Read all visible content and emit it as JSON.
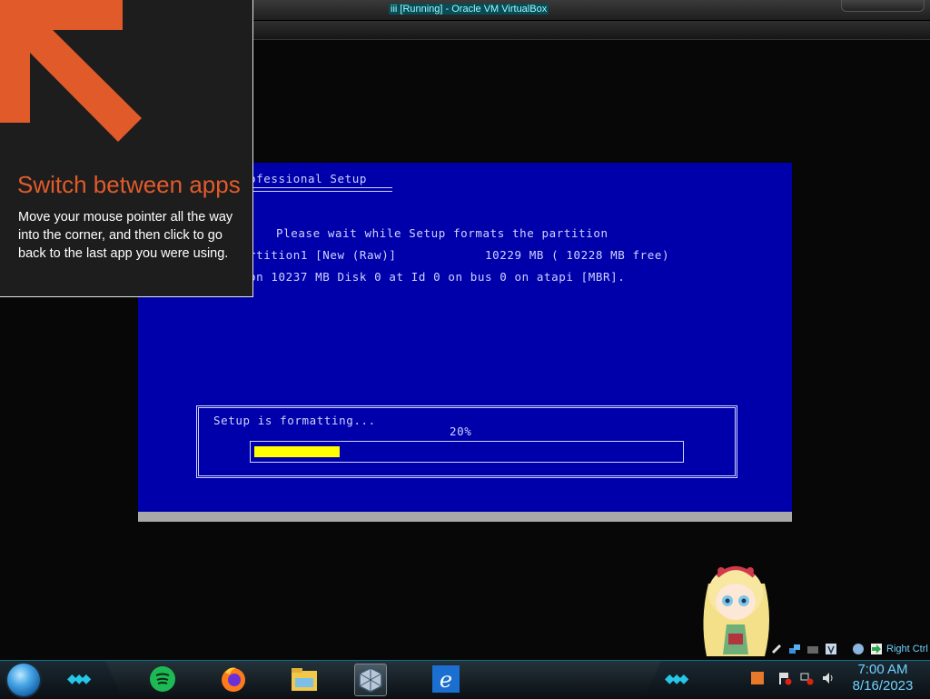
{
  "window": {
    "title": "iii [Running] - Oracle VM VirtualBox"
  },
  "vm": {
    "setup_title": "ofessional Setup",
    "lines": [
      "Please wait while Setup formats the partition",
      "rtition1 [New (Raw)]            10229 MB ( 10228 MB free)",
      "on 10237 MB Disk 0 at Id 0 on bus 0 on atapi [MBR]."
    ],
    "format_label": "Setup is formatting...",
    "percent_label": "20%",
    "progress": 0.2,
    "background_color": "#0000aa",
    "progress_color": "#ffff00"
  },
  "hint": {
    "title": "Switch between apps",
    "body": "Move your mouse pointer all the way into the corner, and then click to go back to the last app you were using.",
    "accent_color": "#e15b2a"
  },
  "tray": {
    "upper_icons": [
      "usb-icon",
      "network-icon",
      "folder-icon",
      "virtualbox-vm-icon",
      "globe-icon",
      "green-arrow-icon"
    ],
    "host_key_label": "Right Ctrl",
    "lower_icons": [
      "orange-app-icon",
      "flag-icon",
      "network-icon",
      "volume-icon"
    ]
  },
  "taskbar": {
    "apps": [
      "spotify-icon",
      "firefox-icon",
      "file-explorer-icon",
      "virtualbox-icon",
      "internet-explorer-icon"
    ],
    "active_app": "virtualbox-icon"
  },
  "clock": {
    "time": "7:00 AM",
    "date": "8/16/2023"
  }
}
